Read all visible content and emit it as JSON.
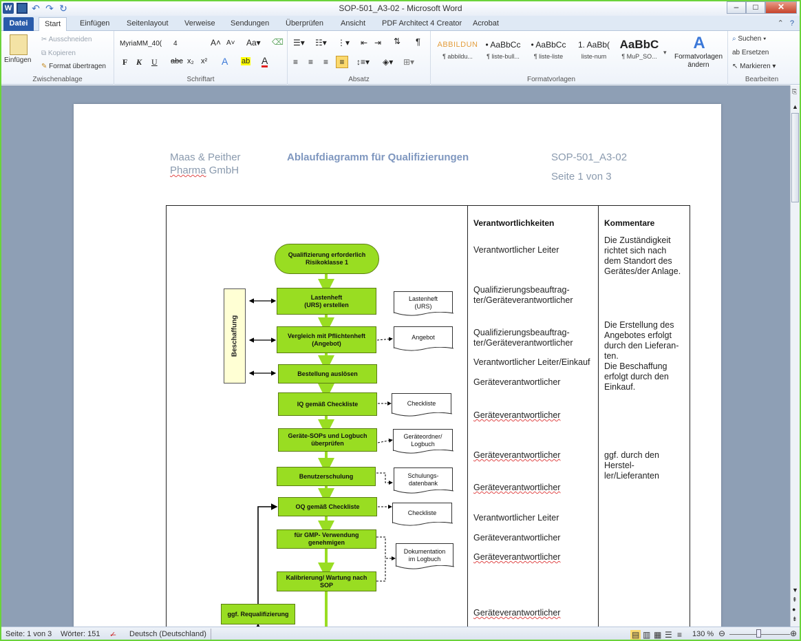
{
  "window": {
    "title": "SOP-501_A3-02 - Microsoft Word",
    "app_icon": "W",
    "minimize": "–",
    "maximize": "□",
    "close": "✕"
  },
  "tabs": [
    "Datei",
    "Start",
    "Einfügen",
    "Seitenlayout",
    "Verweise",
    "Sendungen",
    "Überprüfen",
    "Ansicht",
    "PDF Architect 4 Creator",
    "Acrobat"
  ],
  "ribbon": {
    "clipboard": {
      "paste": "Einfügen",
      "cut": "Ausschneiden",
      "copy": "Kopieren",
      "format_painter": "Format übertragen",
      "label": "Zwischenablage"
    },
    "font": {
      "family": "MyriaMM_40(",
      "size": "4",
      "label": "Schriftart"
    },
    "paragraph": {
      "label": "Absatz"
    },
    "styles": {
      "items": [
        {
          "sample": "ABBILDUN",
          "name": "¶ abbildu..."
        },
        {
          "sample": "• AaBbCc",
          "name": "¶ liste-bull..."
        },
        {
          "sample": "• AaBbCc",
          "name": "¶ liste-liste"
        },
        {
          "sample": "1. AaBb(",
          "name": "liste-num"
        },
        {
          "sample": "AaBbC",
          "name": "¶ MuP_SO..."
        }
      ],
      "change": "Formatvorlagen ändern",
      "label": "Formatvorlagen"
    },
    "editing": {
      "find": "Suchen",
      "replace": "Ersetzen",
      "select": "Markieren",
      "label": "Bearbeiten"
    }
  },
  "document": {
    "header": {
      "company_line1": "Maas & Peither",
      "company_line2a": "Pharma",
      "company_line2b": "GmbH",
      "title": "Ablaufdiagramm  für Qualifizierungen",
      "doc_id": "SOP-501_A3-02",
      "page_of": "Seite 1 von 3"
    },
    "table": {
      "col_responsibilities": "Verantwortlichkeiten",
      "col_comments": "Kommentare",
      "responsibilities": [
        "Verantwortlicher Leiter",
        "Qualifizierungsbeauftrag-\nter/Geräteverantwortlicher",
        "Qualifizierungsbeauftrag-\nter/Geräteverantwortlicher",
        "Verantwortlicher Leiter/Einkauf",
        "Geräteverantwortlicher",
        "Geräteverantwortlicher",
        "Geräteverantwortlicher",
        "Geräteverantwortlicher",
        "Verantwortlicher Leiter",
        "Geräteverantwortlicher",
        "Geräteverantwortlicher",
        "Geräteverantwortlicher"
      ],
      "comments": [
        "Die Zuständigkeit\nrichtet sich nach\ndem Standort des\nGerätes/der Anlage.",
        "Die Erstellung des\nAngebotes erfolgt\ndurch den Lieferan-\nten.\nDie Beschaffung\nerfolgt durch den\nEinkauf.",
        "ggf. durch den\nHerstel-\nler/Lieferanten"
      ]
    },
    "flow": {
      "start": "Qualifizierung erforderlich\nRisikoklasse 1",
      "steps": [
        "Lastenheft\n(URS)  erstellen",
        "Vergleich mit Pflichtenheft\n(Angebot)",
        "Bestellung  auslösen",
        "IQ gemäß Checkliste",
        "Geräte-SOPs und Logbuch\nüberprüfen",
        "Benutzerschulung",
        "OQ gemäß  Checkliste",
        "für GMP- Verwendung\ngenehmigen",
        "Kalibrierung/ Wartung nach\nSOP",
        "ggf. Requalifizierung"
      ],
      "documents": [
        "Lastenheft\n(URS)",
        "Angebot",
        "Checkliste",
        "Geräteordner/\nLogbuch",
        "Schulungs-\ndatenbank",
        "Checkliste",
        "Dokumentation\nim Logbuch"
      ],
      "side_label": "Beschaffung",
      "colors": {
        "step_fill": "#99dd22",
        "arrow": "#99dd22",
        "side_fill": "#ffffd4"
      }
    }
  },
  "status": {
    "page": "Seite: 1 von 3",
    "words": "Wörter: 151",
    "language": "Deutsch (Deutschland)",
    "zoom": "130 %"
  }
}
